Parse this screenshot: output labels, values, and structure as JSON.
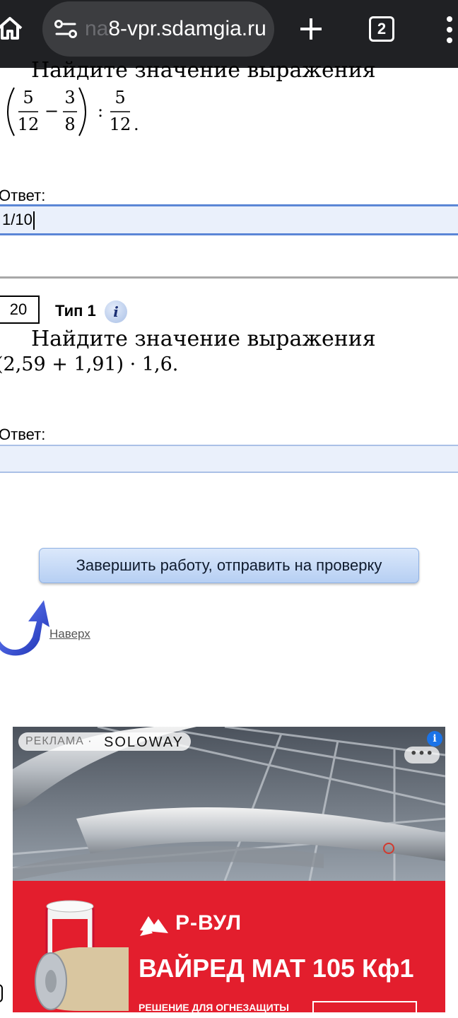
{
  "browser": {
    "url_hidden_prefix": "na",
    "url": "8-vpr.sdamgia.ru",
    "tab_count": "2",
    "icons": [
      "home-icon",
      "site-settings-icon",
      "plus-icon",
      "tab-switcher-icon",
      "more-vert-icon"
    ]
  },
  "prev_question": {
    "text": "Найдите значение выражения",
    "expr": {
      "f1_num": "5",
      "f1_den": "12",
      "minus": "−",
      "f2_num": "3",
      "f2_den": "8",
      "div": ":",
      "f3_num": "5",
      "f3_den": "12",
      "end": "."
    },
    "answer_label": "Ответ:",
    "answer_value": "1/10"
  },
  "question": {
    "number": "20",
    "type": "Тип 1",
    "info_glyph": "i",
    "text": "Найдите значение выражения",
    "expr": "(2,59 + 1,91) · 1,6.",
    "answer_label": "Ответ:",
    "answer_value": ""
  },
  "submit_label": "Завершить работу, отправить на проверку",
  "top_link": "Наверх",
  "ad": {
    "label": "РЕКЛАМА ·",
    "advertiser": "SOLOWAY",
    "info_glyph": "i",
    "more_glyph": "•••",
    "brand": "Р-ВУЛ",
    "product": "ВАЙРЕД МАТ 105 Кф1",
    "subtitle": "РЕШЕНИЕ ДЛЯ ОГНЕЗАЩИТЫ"
  }
}
